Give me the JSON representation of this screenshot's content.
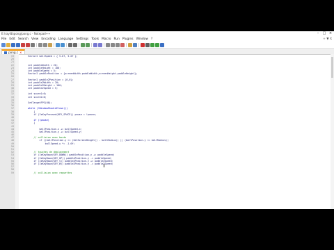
{
  "window": {
    "title": "E:\\raylib\\pong\\pong.c - Notepad++"
  },
  "menu": [
    "File",
    "Edit",
    "Search",
    "View",
    "Encoding",
    "Language",
    "Settings",
    "Tools",
    "Macro",
    "Run",
    "Plugins",
    "Window",
    "?"
  ],
  "menu_right": "+ ▼ X",
  "toolbar_icons": [
    {
      "name": "new-file-icon",
      "color": "#5a8ad6"
    },
    {
      "name": "open-file-icon",
      "color": "#e0b040"
    },
    {
      "name": "save-icon",
      "color": "#3a6fc4"
    },
    {
      "name": "save-all-icon",
      "color": "#3a6fc4"
    },
    {
      "name": "close-icon",
      "color": "#c94040"
    },
    {
      "name": "close-all-icon",
      "color": "#c94040"
    },
    {
      "name": "print-icon",
      "color": "#7a7a7a"
    },
    {
      "name": "cut-icon",
      "color": "#8a8a8a"
    },
    {
      "name": "copy-icon",
      "color": "#8a8a8a"
    },
    {
      "name": "paste-icon",
      "color": "#c8a050"
    },
    {
      "name": "undo-icon",
      "color": "#4a90d0"
    },
    {
      "name": "redo-icon",
      "color": "#4a90d0"
    },
    {
      "name": "find-icon",
      "color": "#6a6a6a"
    },
    {
      "name": "replace-icon",
      "color": "#6a6a6a"
    },
    {
      "name": "zoom-in-icon",
      "color": "#5a9a5a"
    },
    {
      "name": "zoom-out-icon",
      "color": "#5a9a5a"
    },
    {
      "name": "sync-v-icon",
      "color": "#7a7ad0"
    },
    {
      "name": "sync-h-icon",
      "color": "#7a7ad0"
    },
    {
      "name": "word-wrap-icon",
      "color": "#888888"
    },
    {
      "name": "show-all-icon",
      "color": "#888888"
    },
    {
      "name": "indent-guide-icon",
      "color": "#888888"
    },
    {
      "name": "lang-icon",
      "color": "#d06060"
    },
    {
      "name": "folder-workspace-icon",
      "color": "#d0a040"
    },
    {
      "name": "monitor-icon",
      "color": "#5080c0"
    },
    {
      "name": "record-macro-icon",
      "color": "#d03030"
    },
    {
      "name": "stop-macro-icon",
      "color": "#606060"
    },
    {
      "name": "play-macro-icon",
      "color": "#40a040"
    },
    {
      "name": "run-macro-icon",
      "color": "#40a040"
    },
    {
      "name": "save-macro-icon",
      "color": "#3a6fc4"
    }
  ],
  "tabs": [
    {
      "label": "pong.c",
      "close": "×"
    }
  ],
  "lines": [
    {
      "n": "19",
      "text": "    Vector2 ballSpeed = { 5.0f, 5.0f };",
      "kind": "code"
    },
    {
      "n": "20",
      "text": "",
      "kind": "code"
    },
    {
      "n": "21",
      "text": "",
      "kind": "code"
    },
    {
      "n": "22",
      "text": "    int paddleWidth = 20;",
      "kind": "code"
    },
    {
      "n": "23",
      "text": "    int paddleHeight = 100;",
      "kind": "code"
    },
    {
      "n": "24",
      "text": "    int paddleSpeed = 5;",
      "kind": "code"
    },
    {
      "n": "25",
      "text": "    Vector2 paddlePosition = {screenWidth-paddleWidth,screenHeight-paddleHeight};",
      "kind": "code"
    },
    {
      "n": "26",
      "text": "",
      "kind": "code"
    },
    {
      "n": "27",
      "text": "    Vector2 paddle2Position = {0,0};",
      "kind": "code"
    },
    {
      "n": "28",
      "text": "    int paddle2Width = 20;",
      "kind": "code"
    },
    {
      "n": "29",
      "text": "    int paddle2Height = 100;",
      "kind": "code"
    },
    {
      "n": "30",
      "text": "    int paddle2Speed = 5;",
      "kind": "code"
    },
    {
      "n": "31",
      "text": "",
      "kind": "code"
    },
    {
      "n": "32",
      "text": "    int score1=0;",
      "kind": "code"
    },
    {
      "n": "33",
      "text": "    int score2=0;",
      "kind": "code"
    },
    {
      "n": "34",
      "text": "",
      "kind": "code"
    },
    {
      "n": "35",
      "text": "    SetTargetFPS(60);",
      "kind": "code"
    },
    {
      "n": "36",
      "text": "",
      "kind": "code"
    },
    {
      "n": "37",
      "text": "    while (!WindowShouldClose())",
      "kind": "kw"
    },
    {
      "n": "38",
      "text": "        {",
      "kind": "code"
    },
    {
      "n": "39",
      "text": "        if (IsKeyPressed(KEY_SPACE)) pause = !pause;",
      "kind": "code"
    },
    {
      "n": "40",
      "text": "",
      "kind": "code"
    },
    {
      "n": "41",
      "text": "        if (!pause)",
      "kind": "kw"
    },
    {
      "n": "42",
      "text": "        {",
      "kind": "code"
    },
    {
      "n": "43",
      "text": "",
      "kind": "code"
    },
    {
      "n": "44",
      "text": "            ballPosition.x += ballSpeed.x;",
      "kind": "code"
    },
    {
      "n": "45",
      "text": "            ballPosition.y += ballSpeed.y;",
      "kind": "code"
    },
    {
      "n": "46",
      "text": "",
      "kind": "code"
    },
    {
      "n": "47",
      "text": "        // collision avec bords",
      "kind": "comment"
    },
    {
      "n": "48",
      "text": "            if ((ballPosition.y >= (GetScreenHeight() - ballRadius)) || (ballPosition.y <= ballRadius))",
      "kind": "code"
    },
    {
      "n": "49",
      "text": "                ballSpeed.y *= -1.0f;",
      "kind": "code"
    },
    {
      "n": "50",
      "text": "",
      "kind": "code"
    },
    {
      "n": "51",
      "text": "",
      "kind": "code"
    },
    {
      "n": "52",
      "text": "        // touches de déplacement",
      "kind": "comment"
    },
    {
      "n": "53",
      "text": "        if (IsKeyDown(KEY_DOWN)) paddlePosition.y += paddleSpeed;",
      "kind": "code"
    },
    {
      "n": "54",
      "text": "        if (IsKeyDown(KEY_UP)) paddlePosition.y -= paddleSpeed;",
      "kind": "code"
    },
    {
      "n": "55",
      "text": "        if (IsKeyDown(KEY_S)) paddle2Position.y += paddle2Speed;",
      "kind": "code"
    },
    {
      "n": "56",
      "text": "        if (IsKeyDown(KEY_W)) paddle2Position.y -= paddle2Speed;",
      "kind": "code"
    },
    {
      "n": "57",
      "text": "",
      "kind": "code"
    },
    {
      "n": "58",
      "text": "",
      "kind": "code"
    },
    {
      "n": "59",
      "text": "        // collision avec raquettes",
      "kind": "comment"
    }
  ]
}
